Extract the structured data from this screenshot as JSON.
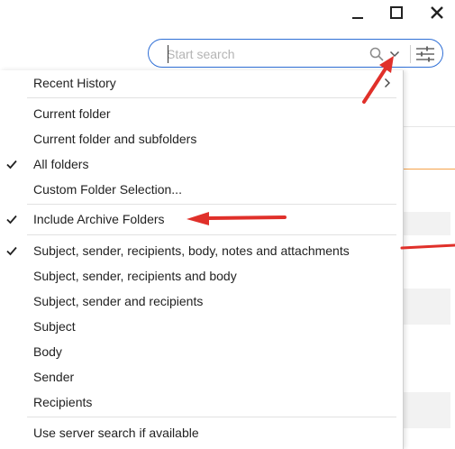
{
  "window": {
    "minimize_icon": "minimize-icon",
    "maximize_icon": "maximize-icon",
    "close_icon": "close-icon"
  },
  "search": {
    "placeholder": "Start search",
    "value": "",
    "accent_color": "#2f6fd6"
  },
  "menu": {
    "recent_history": "Recent History",
    "scope": [
      {
        "label": "Current folder",
        "checked": false
      },
      {
        "label": "Current folder and subfolders",
        "checked": false
      },
      {
        "label": "All folders",
        "checked": true
      },
      {
        "label": "Custom Folder Selection...",
        "checked": false
      }
    ],
    "archive": {
      "label": "Include Archive Folders",
      "checked": true
    },
    "fields": [
      {
        "label": "Subject, sender, recipients, body, notes and attachments",
        "checked": true
      },
      {
        "label": "Subject, sender, recipients and body",
        "checked": false
      },
      {
        "label": "Subject, sender and recipients",
        "checked": false
      },
      {
        "label": "Subject",
        "checked": false
      },
      {
        "label": "Body",
        "checked": false
      },
      {
        "label": "Sender",
        "checked": false
      },
      {
        "label": "Recipients",
        "checked": false
      }
    ],
    "server": {
      "label": "Use server search if available",
      "checked": false
    }
  },
  "annotation": {
    "arrow_color": "#e0302a"
  }
}
